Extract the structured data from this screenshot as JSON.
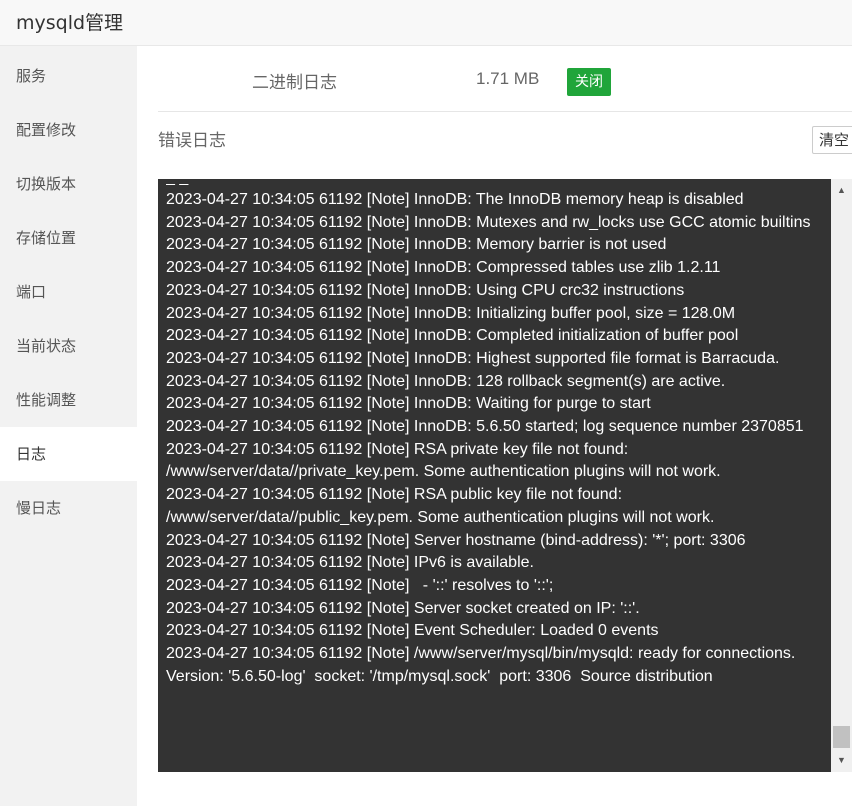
{
  "window": {
    "title": "mysqld管理"
  },
  "sidebar": {
    "items": [
      {
        "label": "服务"
      },
      {
        "label": "配置修改"
      },
      {
        "label": "切换版本"
      },
      {
        "label": "存储位置"
      },
      {
        "label": "端口"
      },
      {
        "label": "当前状态"
      },
      {
        "label": "性能调整"
      },
      {
        "label": "日志",
        "active": true
      },
      {
        "label": "慢日志"
      }
    ]
  },
  "binlog": {
    "label": "二进制日志",
    "size": "1.71 MB",
    "status": "关闭",
    "status_color": "#20a53a"
  },
  "errorlog": {
    "title": "错误日志",
    "clear_label": "清空",
    "lines": [
      "2023-04-27 10:34:05 61192 [Note] InnoDB: The InnoDB memory heap is disabled",
      "2023-04-27 10:34:05 61192 [Note] InnoDB: Mutexes and rw_locks use GCC atomic builtins",
      "2023-04-27 10:34:05 61192 [Note] InnoDB: Memory barrier is not used",
      "2023-04-27 10:34:05 61192 [Note] InnoDB: Compressed tables use zlib 1.2.11",
      "2023-04-27 10:34:05 61192 [Note] InnoDB: Using CPU crc32 instructions",
      "2023-04-27 10:34:05 61192 [Note] InnoDB: Initializing buffer pool, size = 128.0M",
      "2023-04-27 10:34:05 61192 [Note] InnoDB: Completed initialization of buffer pool",
      "2023-04-27 10:34:05 61192 [Note] InnoDB: Highest supported file format is Barracuda.",
      "2023-04-27 10:34:05 61192 [Note] InnoDB: 128 rollback segment(s) are active.",
      "2023-04-27 10:34:05 61192 [Note] InnoDB: Waiting for purge to start",
      "2023-04-27 10:34:05 61192 [Note] InnoDB: 5.6.50 started; log sequence number 2370851",
      "2023-04-27 10:34:05 61192 [Note] RSA private key file not found: /www/server/data//private_key.pem. Some authentication plugins will not work.",
      "2023-04-27 10:34:05 61192 [Note] RSA public key file not found: /www/server/data//public_key.pem. Some authentication plugins will not work.",
      "2023-04-27 10:34:05 61192 [Note] Server hostname (bind-address): '*'; port: 3306",
      "2023-04-27 10:34:05 61192 [Note] IPv6 is available.",
      "2023-04-27 10:34:05 61192 [Note]   - '::' resolves to '::';",
      "2023-04-27 10:34:05 61192 [Note] Server socket created on IP: '::'.",
      "2023-04-27 10:34:05 61192 [Note] Event Scheduler: Loaded 0 events",
      "2023-04-27 10:34:05 61192 [Note] /www/server/mysql/bin/mysqld: ready for connections.",
      "Version: '5.6.50-log'  socket: '/tmp/mysql.sock'  port: 3306  Source distribution"
    ]
  }
}
